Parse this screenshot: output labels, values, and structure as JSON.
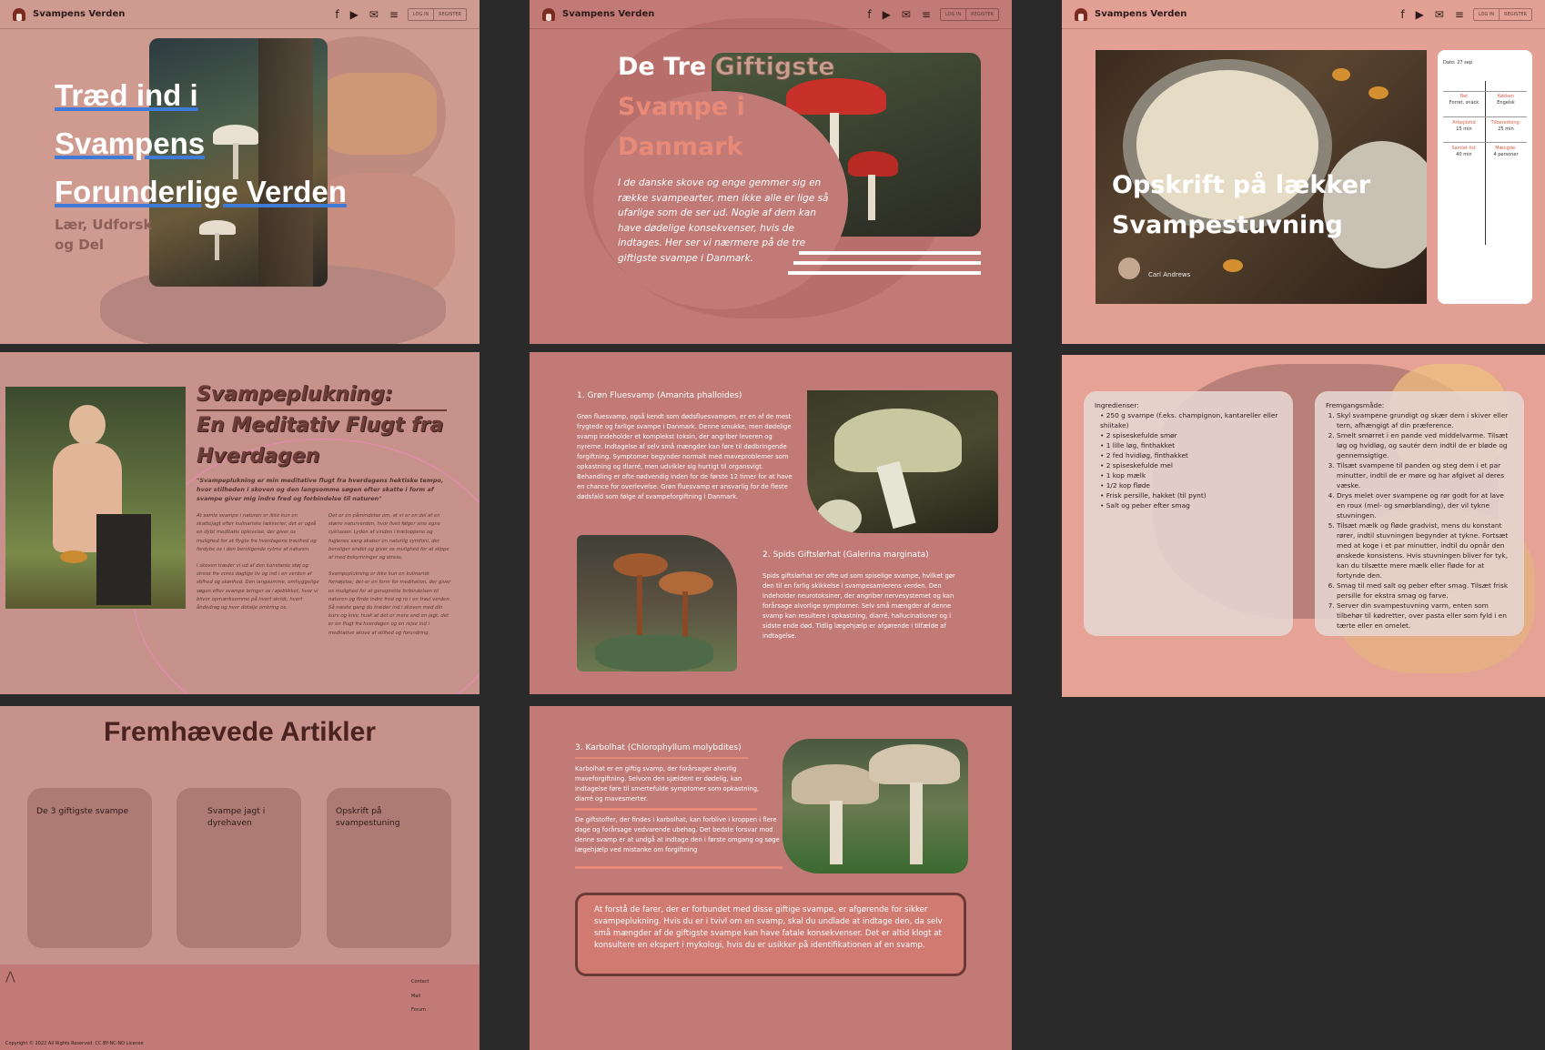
{
  "nav": {
    "brand": "Svampens Verden",
    "icons": [
      "facebook-icon",
      "play-icon",
      "mail-icon",
      "menu-icon"
    ],
    "login": "LOG IN",
    "register": "REGISTER"
  },
  "hero": {
    "title_lines": [
      "Træd ind i",
      "Svampens",
      "Forunderlige Verden"
    ],
    "subtitle": "Lær, Udforsk og Del"
  },
  "poison": {
    "title_a": "De Tre ",
    "title_b": "Giftigste",
    "title_c": "Svampe i Danmark",
    "intro": "I de danske skove og enge gemmer sig en række svampearter, men ikke alle er lige så ufarlige som de ser ud. Nogle af dem kan have dødelige konsekvenser, hvis de indtages. Her ser vi nærmere på de tre giftigste svampe i Danmark."
  },
  "recipe": {
    "title": "Opskrift på lækker Svampestuvning",
    "author": "Carl Andrews",
    "card": {
      "date": "Dato: 27 sep",
      "ret_label": "Ret",
      "ret_value": "Forret, snack",
      "kokken_label": "Køkken",
      "kokken_value": "Engelsk",
      "arbejdstid_label": "Arbejdstid",
      "arbejdstid_value": "15 min",
      "tilberedning_label": "Tilberedning:",
      "tilberedning_value": "25 min",
      "samlet_label": "Samlet tid:",
      "samlet_value": "40 min",
      "maengde_label": "Mængde:",
      "maengde_value": "4 personer"
    }
  },
  "meditation": {
    "title_lines": [
      "Svampeplukning:",
      "En Meditativ Flugt fra",
      "Hverdagen"
    ],
    "quote": "\"Svampeplukning er min meditative flugt fra hverdagens hektiske tempo, hvor stilheden i skoven og den langsomme søgen efter skatte i form af svampe giver mig indre fred og forbindelse til naturen\"",
    "col1_p1": "At samle svampe i naturen er ikke kun en skattejagt efter kulinariske lækkerier, det er også en dybt meditativ oplevelse, der giver os mulighed for at flygte fra hverdagens travlhed og fordybe os i den beroligende rytme af naturen.",
    "col1_p2": "I skoven træder vi ud af den konstante støj og stress fra vores daglige liv og ind i en verden af stilhed og skønhed. Den langsomme, omhyggelige søgen efter svampe bringer os i øjeblikket, hvor vi bliver opmærksomme på hvert skridt, hvert åndedrag og hver detalje omkring os.",
    "col2_p1": "Det er en påmindelse om, at vi er en del af en større naturverden, hvor livet følger sine egne cyklusser. Lyden af vinden i trætoppene og fuglenes sang skaber en naturlig symfoni, der beroliger sindet og giver os mulighed for at slippe af med bekymringer og stress.",
    "col2_p2": "Svampeplukning er ikke kun en kulinarisk fornøjelse; det er en form for meditation, der giver os mulighed for at genoprette forbindelsen til naturen og finde indre fred og ro i en travl verden. Så næste gang du træder ind i skoven med din kurv og kniv, husk at det er mere end en jagt, det er en flugt fra hverdagen og en rejse ind i meditative skove af stilhed og forundring."
  },
  "species": {
    "s1_title": "1. Grøn Fluesvamp (Amanita phalloides)",
    "s1_body": "Grøn fluesvamp, også kendt som dødsfluesvampen, er en af de mest frygtede og farlige svampe i Danmark. Denne smukke, men dødelige svamp indeholder et komplekst toksin, der angriber leveren og nyrerne. Indtagelse af selv små mængder kan føre til dødbringende forgiftning. Symptomer begynder normalt med maveproblemer som opkastning og diarré, men udvikler sig hurtigt til organsvigt. Behandling er ofte nødvendig inden for de første 12 timer for at have en chance for overlevelse. Grøn fluesvamp er ansvarlig for de fleste dødsfald som følge af svampeforgiftning i Danmark.",
    "s2_title": "2. Spids Giftslørhat (Galerina marginata)",
    "s2_body": "Spids giftslørhat ser ofte ud som spiselige svampe, hvilket gør den til en farlig skikkelse i svampesamlerens verden. Den indeholder neurotoksiner, der angriber nervesystemet og kan forårsage alvorlige symptomer. Selv små mængder af denne svamp kan resultere i opkastning, diarré, hallucinationer og i sidste ende død. Tidlig lægehjælp er afgørende i tilfælde af indtagelse.",
    "s3_title": "3. Karbolhat (Chlorophyllum molybdites)",
    "s3_body1": "Karbolhat er en giftig svamp, der forårsager alvorlig maveforgiftning. Selvom den sjældent er dødelig, kan indtagelse føre til smertefulde symptomer som opkastning, diarré og mavesmerter.",
    "s3_body2": "De giftstoffer, der findes i karbolhat, kan forblive i kroppen i flere dage og forårsage vedvarende ubehag. Det bedste forsvar mod denne svamp er at undgå at indtage den i første omgang og søge lægehjælp ved mistanke om forgiftning",
    "warning": "At forstå de farer, der er forbundet med disse giftige svampe, er afgørende for sikker svampeplukning. Hvis du er i tvivl om en svamp, skal du undlade at indtage den, da selv små mængder af de giftigste svampe kan have fatale konsekvenser. Det er altid klogt at konsultere en ekspert i mykologi, hvis du er usikker på identifikationen af en svamp."
  },
  "ingredients": {
    "label": "Ingredienser:",
    "items": [
      "250 g svampe (f.eks. champignon, kantareller eller shiitake)",
      "2 spiseskefulde smør",
      "1 lille løg, finthakket",
      "2 fed hvidløg, finthakket",
      "2 spiseskefulde mel",
      "1 kop mælk",
      "1/2 kop fløde",
      "Frisk persille, hakket (til pynt)",
      "Salt og peber efter smag"
    ]
  },
  "method": {
    "label": "Fremgangsmåde:",
    "steps": [
      "Skyl svampene grundigt og skær dem i skiver eller tern, afhængigt af din præference.",
      "Smelt smørret i en pande ved middelvarme. Tilsæt løg og hvidløg, og sautér dem indtil de er bløde og gennemsigtige.",
      "Tilsæt svampene til panden og steg dem i et par minutter, indtil de er møre og har afgivet al deres væske.",
      "Drys melet over svampene og rør godt for at lave en roux (mel- og smørblanding), der vil tykne stuvningen.",
      "Tilsæt mælk og fløde gradvist, mens du konstant rører, indtil stuvningen begynder at tykne. Fortsæt med at koge i et par minutter, indtil du opnår den ønskede konsistens. Hvis stuvningen bliver for tyk, kan du tilsætte mere mælk eller fløde for at fortynde den.",
      "Smag til med salt og peber efter smag. Tilsæt frisk persille for ekstra smag og farve.",
      "Server din svampestuvning varm, enten som tilbehør til kødretter, over pasta eller som fyld i en tærte eller en omelet."
    ]
  },
  "featured": {
    "title": "Fremhævede Artikler",
    "cards": [
      "De 3 giftigste svampe",
      "Svampe jagt i dyrehaven",
      "Opskrift på svampestuning"
    ]
  },
  "footer": {
    "links": [
      "Contact",
      "Mail",
      "Forum"
    ],
    "copyright": "Copyright © 2022 All Rights Reserved. CC BY-NC-ND License"
  },
  "colors": {
    "accent_blue": "#3e7ad8",
    "coral": "#e88a78",
    "panel_dark": "#c27a76",
    "panel_light": "#cf9a90"
  }
}
